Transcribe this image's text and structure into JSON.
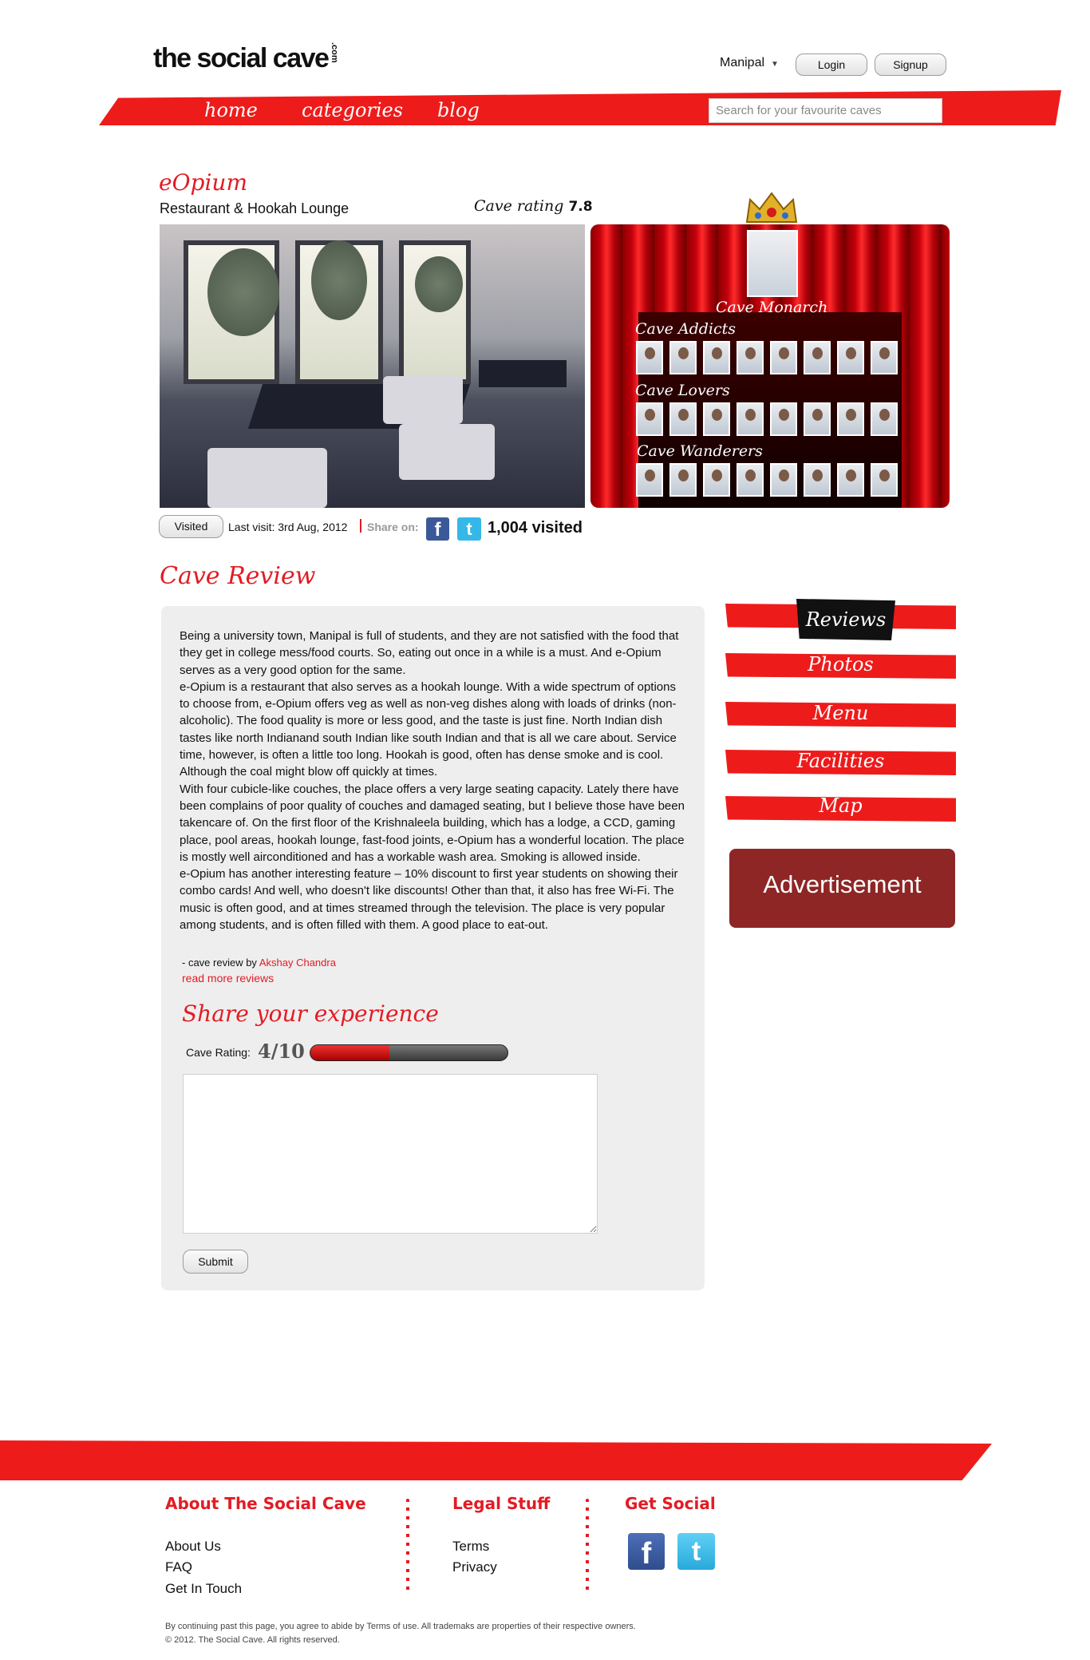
{
  "header": {
    "logo": "the social cave",
    "logo_suffix": ".com",
    "city": "Manipal",
    "login_label": "Login",
    "signup_label": "Signup"
  },
  "nav": {
    "items": [
      {
        "label": "home"
      },
      {
        "label": "categories"
      },
      {
        "label": "blog"
      }
    ],
    "search_placeholder": "Search for your favourite caves"
  },
  "cave": {
    "name": "eOpium",
    "type": "Restaurant & Hookah Lounge",
    "rating_label": "Cave rating",
    "rating_value": "7.8"
  },
  "stage": {
    "monarch_label": "Cave Monarch",
    "groups": [
      {
        "label": "Cave Addicts",
        "count": 8
      },
      {
        "label": "Cave Lovers",
        "count": 8
      },
      {
        "label": "Cave Wanderers",
        "count": 8
      }
    ]
  },
  "info": {
    "visited_label": "Visited",
    "last_visit": "Last visit: 3rd Aug, 2012",
    "share_on": "Share on:",
    "visited_count": "1,004 visited"
  },
  "review": {
    "section_title": "Cave Review",
    "paragraphs": [
      "Being a university town, Manipal is full of students, and they are not satisfied with the food that they get in college mess/food courts. So, eating out once in a while is a must. And e-Opium serves as a very good option for the same.",
      "e-Opium is a restaurant that also serves as a hookah lounge. With a wide spectrum of options to choose from, e-Opium offers veg as well as non-veg dishes along with loads of drinks (non-alcoholic). The food quality is more or less good, and the taste is just fine. North Indian dish tastes like north Indianand south Indian like south Indian and that is all we care about. Service time, however, is often a little too long. Hookah is good, often has dense smoke and is cool. Although the coal might blow off quickly at times.",
      "With four cubicle-like couches, the place offers a very large seating capacity. Lately there have been complains of poor quality of couches and damaged seating, but I believe those have been takencare of. On the first floor of the Krishnaleela building, which has a lodge, a CCD, gaming place, pool areas, hookah lounge, fast-food joints, e-Opium has a wonderful location. The place is mostly well airconditioned and has a workable wash area. Smoking is allowed inside.",
      "e-Opium has another interesting feature – 10% discount to first year students on showing their combo cards! And well, who doesn't like discounts! Other than that, it also has free Wi-Fi. The music is often good, and at times streamed through the television. The place is very popular among students, and is often filled with them. A good place to eat-out."
    ],
    "by_prefix": "- cave review by",
    "author": "Akshay Chandra",
    "read_more": "read more reviews"
  },
  "share": {
    "title": "Share your experience",
    "rating_label": "Cave Rating:",
    "rating_text": "4/10",
    "rating_fraction": 0.4,
    "textarea_value": "",
    "submit_label": "Submit"
  },
  "tabs": [
    {
      "label": "Reviews",
      "active": true
    },
    {
      "label": "Photos"
    },
    {
      "label": "Menu"
    },
    {
      "label": "Facilities"
    },
    {
      "label": "Map"
    }
  ],
  "advertisement": "Advertisement",
  "footer": {
    "about_title": "About The Social Cave",
    "about_links": [
      "About Us",
      "FAQ",
      "Get In Touch"
    ],
    "legal_title": "Legal Stuff",
    "legal_links": [
      "Terms",
      "Privacy"
    ],
    "social_title": "Get Social",
    "fine_print_1": "By continuing past this page, you agree to abide by Terms of use. All trademaks are properties of their respective owners.",
    "fine_print_2": "© 2012. The Social Cave. All rights reserved."
  },
  "colors": {
    "accent_red": "#ee1b1b",
    "text_red": "#e31b23",
    "ad_bg": "#8e2626",
    "review_bg": "#eeeeee"
  }
}
